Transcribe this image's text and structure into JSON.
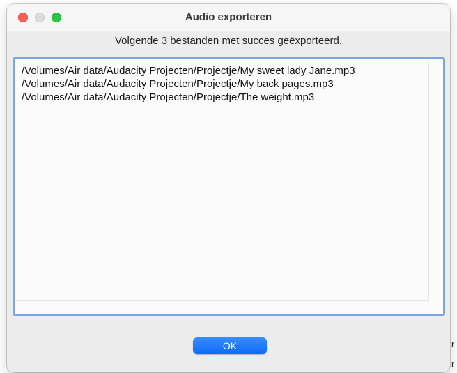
{
  "window": {
    "title": "Audio exporteren"
  },
  "dialog": {
    "message": "Volgende 3 bestanden met succes geëxporteerd.",
    "files": [
      "/Volumes/Air data/Audacity Projecten/Projectje/My sweet lady Jane.mp3",
      "/Volumes/Air data/Audacity Projecten/Projectje/My back pages.mp3",
      "/Volumes/Air data/Audacity Projecten/Projectje/The weight.mp3"
    ],
    "ok_label": "OK"
  },
  "background": {
    "edge_chars": [
      "r",
      "r"
    ]
  },
  "colors": {
    "accent": "#0b6cf5",
    "focus_ring": "#79a6e8",
    "close": "#fe5f57",
    "zoom": "#28c840"
  }
}
